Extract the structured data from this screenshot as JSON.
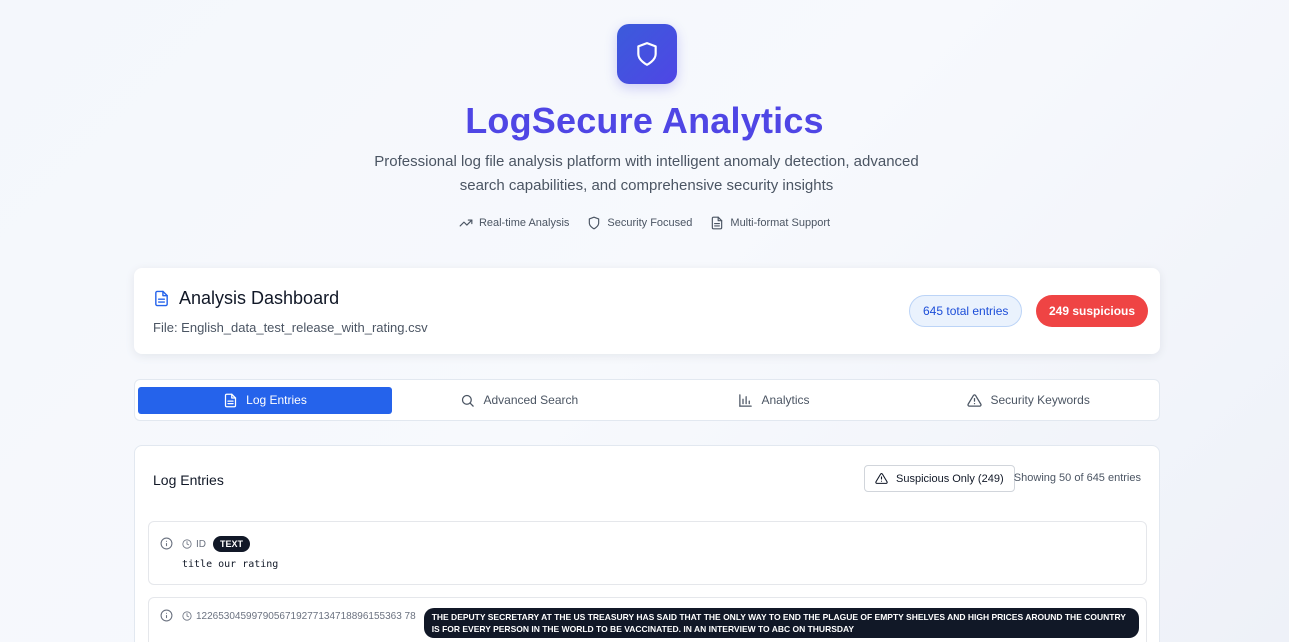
{
  "app": {
    "title": "LogSecure Analytics",
    "subtitle": "Professional log file analysis platform with intelligent anomaly detection, advanced search capabilities, and comprehensive security insights",
    "features": [
      {
        "icon": "trending-up-icon",
        "label": "Real-time Analysis"
      },
      {
        "icon": "shield-icon",
        "label": "Security Focused"
      },
      {
        "icon": "file-text-icon",
        "label": "Multi-format Support"
      }
    ]
  },
  "dashboard": {
    "title": "Analysis Dashboard",
    "file": "File: English_data_test_release_with_rating.csv",
    "total_badge": "645 total entries",
    "suspicious_badge": "249 suspicious"
  },
  "tabs": [
    {
      "label": "Log Entries",
      "icon": "file-text-icon",
      "active": true
    },
    {
      "label": "Advanced Search",
      "icon": "search-icon",
      "active": false
    },
    {
      "label": "Analytics",
      "icon": "bar-chart-icon",
      "active": false
    },
    {
      "label": "Security Keywords",
      "icon": "alert-triangle-icon",
      "active": false
    }
  ],
  "log_panel": {
    "title": "Log Entries",
    "filter_label": "Suspicious Only (249)",
    "showing": "Showing 50 of 645 entries",
    "entries": [
      {
        "timestamp": "ID",
        "tag": "TEXT",
        "message": "title our rating"
      },
      {
        "timestamp": "1226530459979056719277134718896155363 78",
        "tag": "THE DEPUTY SECRETARY AT THE US TREASURY HAS SAID THAT THE ONLY WAY TO END THE PLAGUE OF EMPTY SHELVES AND HIGH PRICES AROUND THE COUNTRY IS FOR EVERY PERSON IN THE WORLD TO BE VACCINATED. IN AN INTERVIEW TO ABC ON THURSDAY"
      }
    ]
  },
  "colors": {
    "accent": "#4f46e5",
    "primary": "#2563eb",
    "danger": "#ef4444"
  }
}
